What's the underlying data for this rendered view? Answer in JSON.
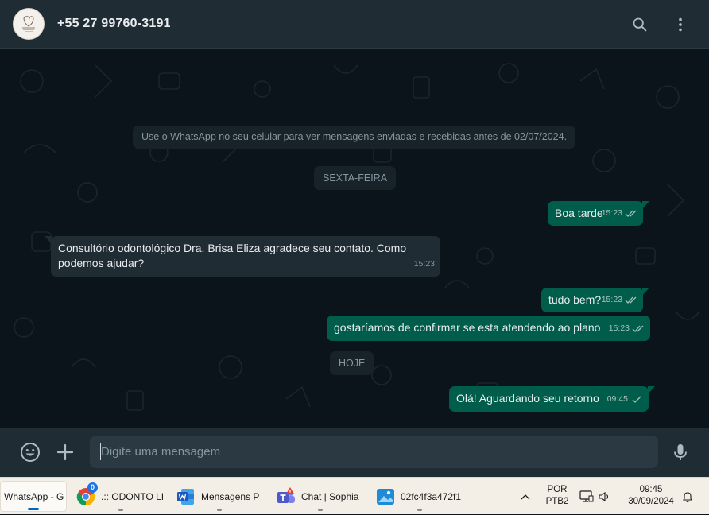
{
  "header": {
    "contact_name": "+55 27 99760-3191",
    "avatar_icon": "clinic-logo-icon",
    "search_icon": "search-icon",
    "menu_icon": "kebab-menu-icon"
  },
  "chat": {
    "system_note": "Use o WhatsApp no seu celular para ver mensagens enviadas e recebidas antes de 02/07/2024.",
    "date_friday": "SEXTA-FEIRA",
    "date_today": "HOJE",
    "messages": [
      {
        "direction": "out",
        "text": "Boa tarde",
        "time": "15:23",
        "status": "read"
      },
      {
        "direction": "in",
        "text_line1": "Consultório odontológico Dra. Brisa Eliza agradece seu contato. Como",
        "text_line2": "podemos ajudar?",
        "time": "15:23"
      },
      {
        "direction": "out",
        "text": "tudo bem?",
        "time": "15:23",
        "status": "read"
      },
      {
        "direction": "out",
        "text": "gostaríamos de confirmar se esta atendendo ao plano",
        "time": "15:23",
        "status": "read"
      },
      {
        "direction": "out",
        "text": "Olá! Aguardando seu retorno",
        "time": "09:45",
        "status": "sent"
      }
    ]
  },
  "composer": {
    "placeholder": "Digite uma mensagem",
    "emoji_icon": "emoji-icon",
    "attach_icon": "plus-icon",
    "mic_icon": "microphone-icon"
  },
  "taskbar": {
    "items": [
      {
        "label": "WhatsApp - G",
        "icon": "whatsapp-icon"
      },
      {
        "label": ".:: ODONTO LI",
        "icon": "chrome-icon",
        "badge": "0"
      },
      {
        "label": "Mensagens P",
        "icon": "word-icon"
      },
      {
        "label": "Chat | Sophia",
        "icon": "teams-icon"
      },
      {
        "label": "02fc4f3a472f1",
        "icon": "photos-icon"
      }
    ],
    "lang_line1": "POR",
    "lang_line2": "PTB2",
    "time": "09:45",
    "date": "30/09/2024"
  },
  "colors": {
    "header_bg": "#202c33",
    "chat_bg": "#0b141a",
    "outgoing_bubble": "#005c4b",
    "incoming_bubble": "#202c33",
    "read_ticks": "#a5c2bc",
    "taskbar_bg": "#f3efe6"
  }
}
